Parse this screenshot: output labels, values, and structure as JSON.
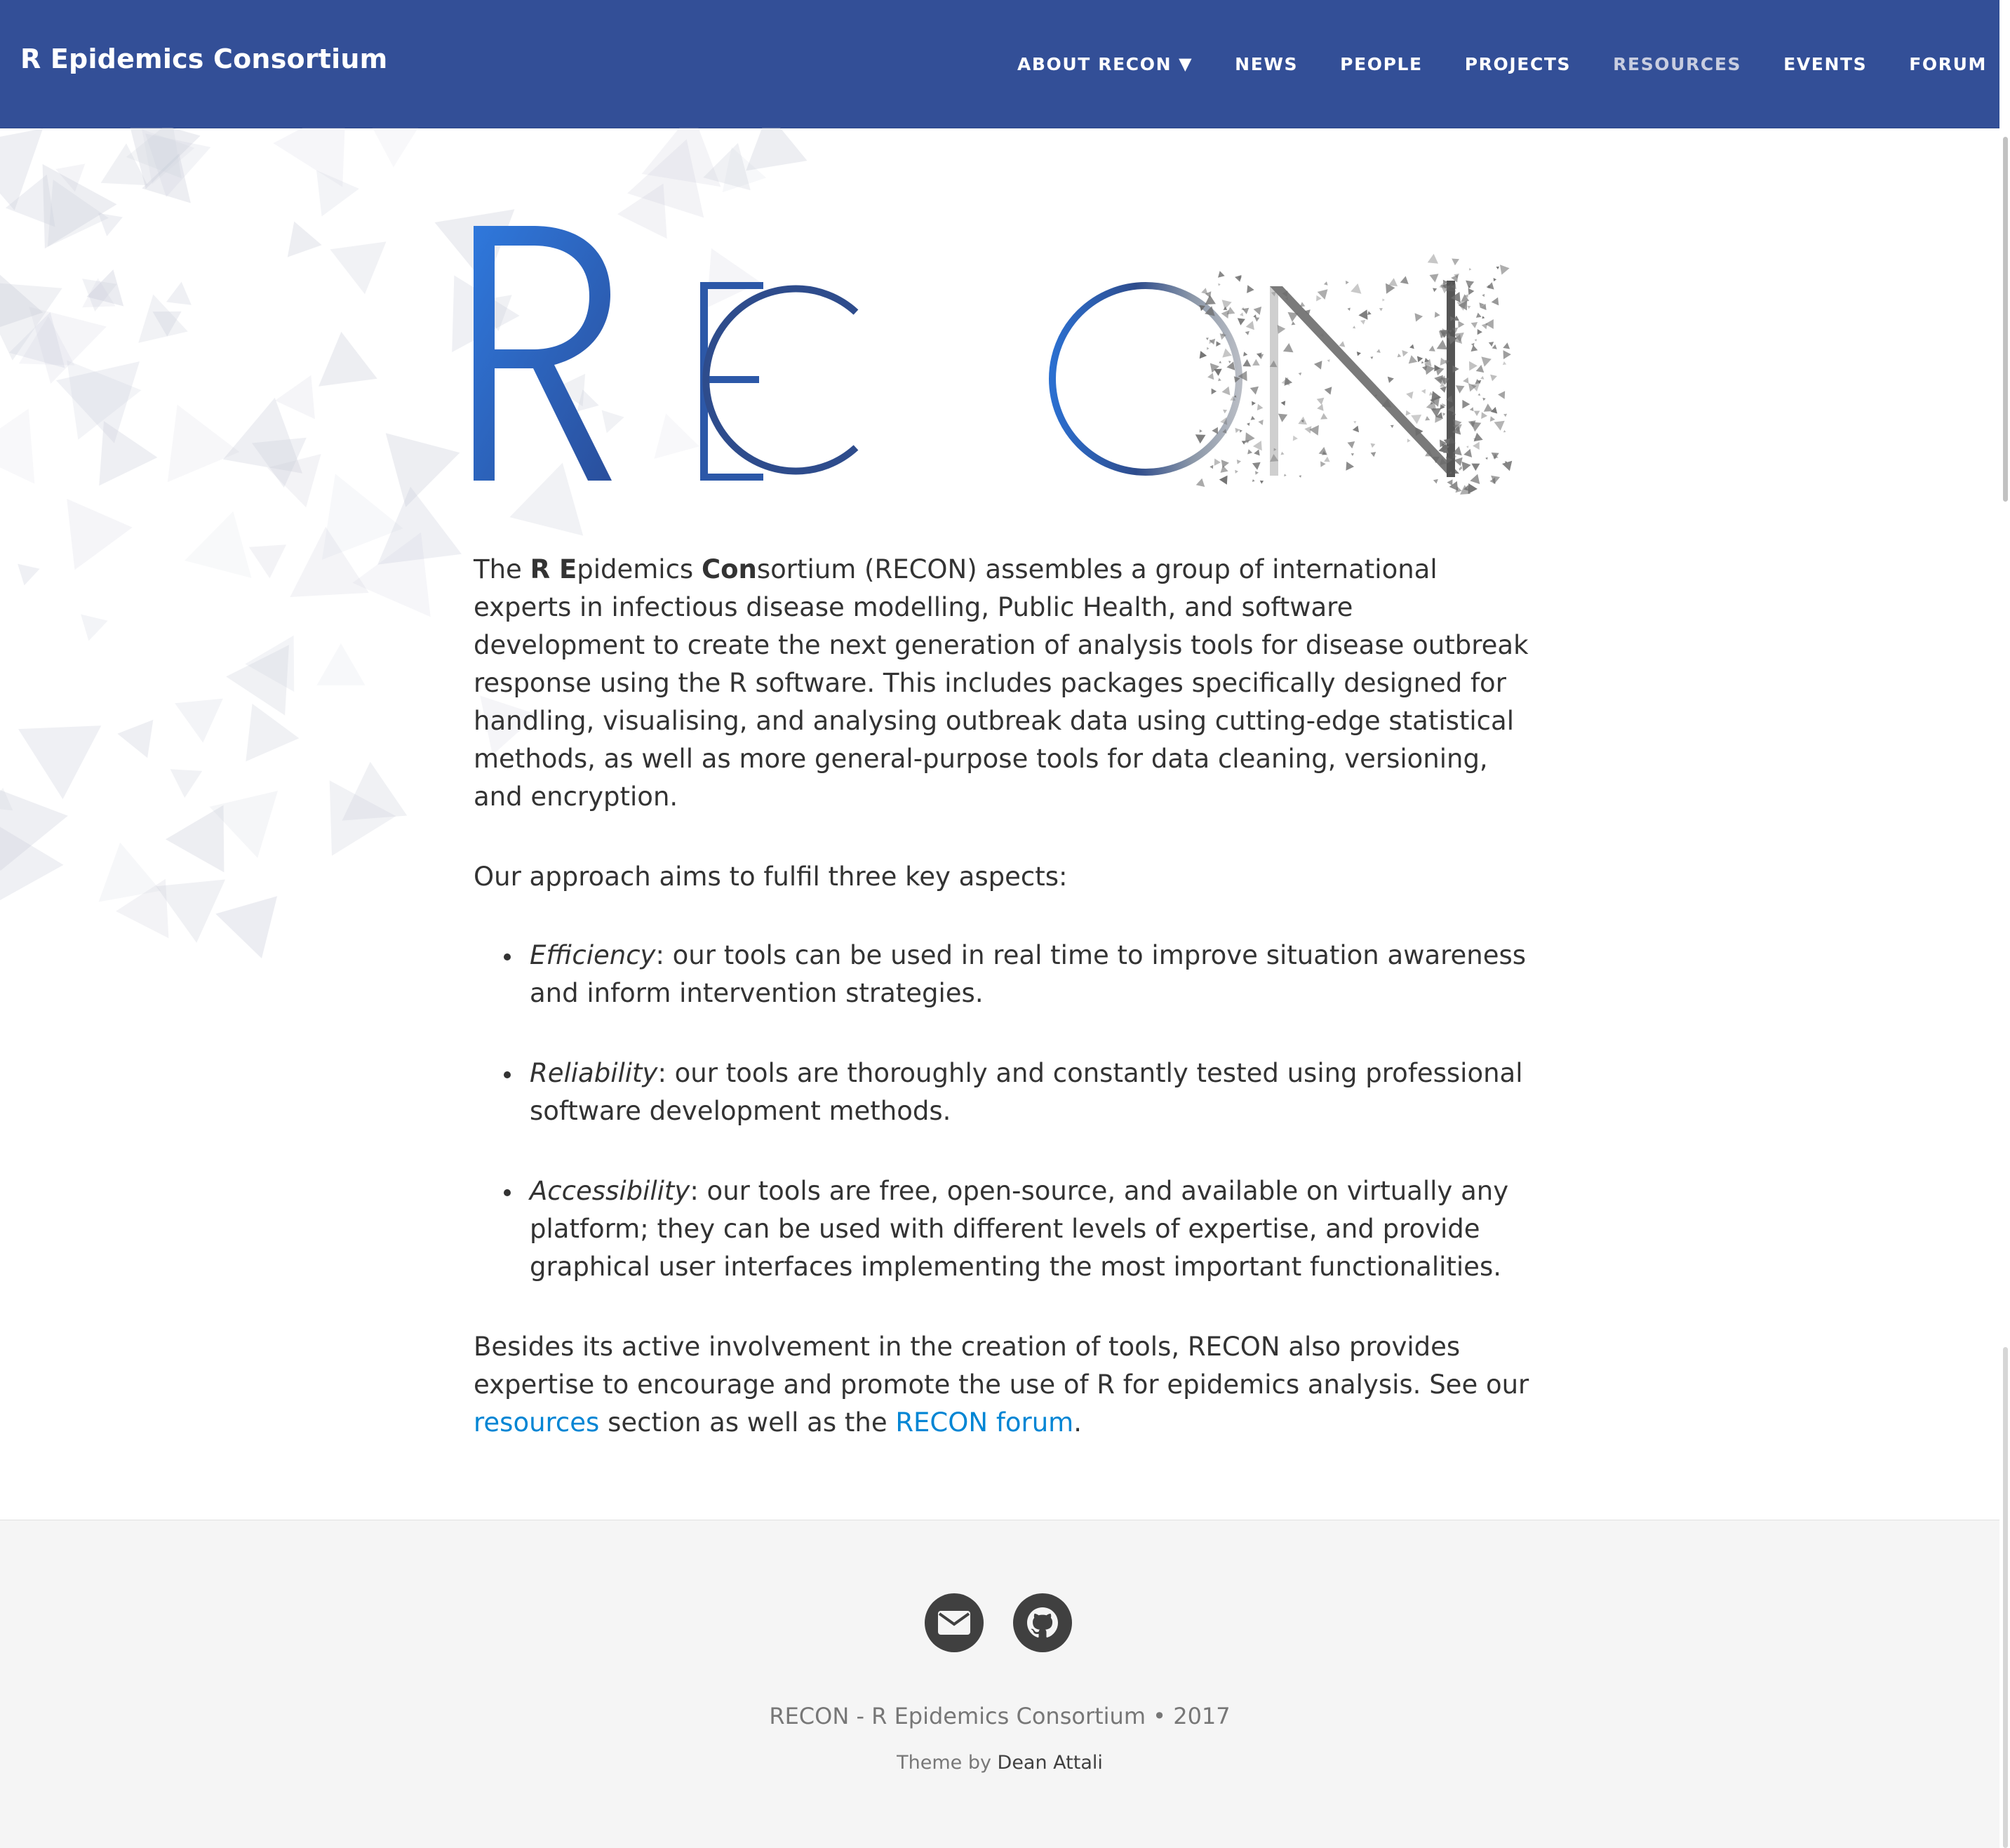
{
  "navbar": {
    "brand": "R Epidemics Consortium",
    "items": [
      {
        "label": "ABOUT RECON",
        "caret": "▼"
      },
      {
        "label": "NEWS"
      },
      {
        "label": "PEOPLE"
      },
      {
        "label": "PROJECTS"
      },
      {
        "label": "RESOURCES"
      },
      {
        "label": "EVENTS"
      },
      {
        "label": "FORUM"
      }
    ],
    "active_item": "RESOURCES",
    "colors": {
      "background": "#334f97",
      "text": "#ffffff",
      "active_text": "#c8cde0"
    }
  },
  "logo": {
    "letters": [
      "R",
      "E",
      "C",
      "O",
      "N"
    ],
    "gradient": [
      "#2b6fd0",
      "#2e4c8c",
      "#8b97a8"
    ]
  },
  "content": {
    "intro": {
      "t1": "The ",
      "b1": "R E",
      "t2": "pidemics ",
      "b2": "Con",
      "t3": "sortium (RECON) assembles a group of international experts in infectious disease modelling, Public Health, and software development to create the next generation of analysis tools for disease outbreak response using the R software. This includes packages specifically designed for handling, visualising, and analysing outbreak data using cutting-edge statistical methods, as well as more general-purpose tools for data cleaning, versioning, and encryption."
    },
    "approach": "Our approach aims to fulfil three key aspects:",
    "bullets": [
      {
        "term": "Efficiency",
        "text": ": our tools can be used in real time to improve situation awareness and inform intervention strategies."
      },
      {
        "term": "Reliability",
        "text": ": our tools are thoroughly and constantly tested using professional software development methods."
      },
      {
        "term": "Accessibility",
        "text": ": our tools are free, open-source, and available on virtually any platform; they can be used with different levels of expertise, and provide graphical user interfaces implementing the most important functionalities."
      }
    ],
    "closing": {
      "t1": "Besides its active involvement in the creation of tools, RECON also provides expertise to encourage and promote the use of R for epidemics analysis. See our ",
      "link1": "resources",
      "t2": " section as well as the ",
      "link2": "RECON forum",
      "t3": "."
    },
    "link_color": "#0085d4"
  },
  "footer": {
    "icons": [
      "email-icon",
      "github-icon"
    ],
    "copyright": "RECON - R Epidemics Consortium  •  2017",
    "theme_prefix": "Theme by ",
    "theme_author": "Dean Attali"
  }
}
